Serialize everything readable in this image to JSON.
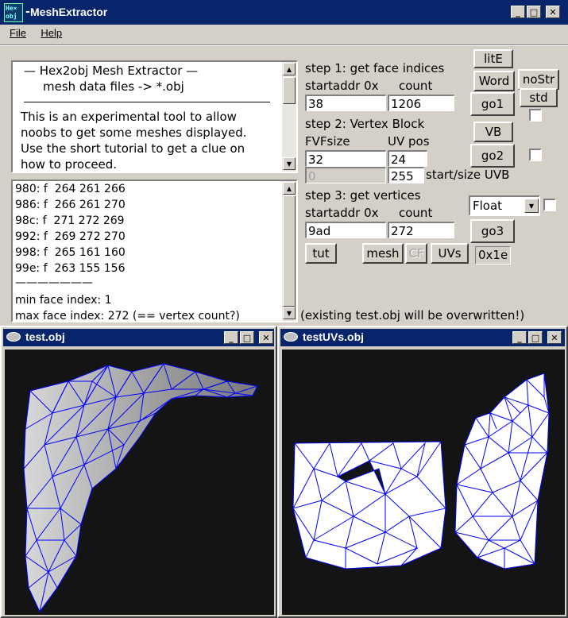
{
  "window": {
    "title": "MeshExtractor",
    "icon_text": "He×\nobj"
  },
  "menu": {
    "file": "File",
    "help": "Help"
  },
  "info": {
    "line1": "—   Hex2obj Mesh Extractor   —",
    "line2": "mesh data files -> *.obj",
    "body": [
      "This is an experimental tool to allow",
      "noobs to get some meshes displayed.",
      "Use the short tutorial to get a clue on",
      "how to proceed."
    ]
  },
  "log": {
    "lines": [
      "980: f  264 261 266",
      "986: f  266 261 270",
      "98c: f  271 272 269",
      "992: f  269 272 270",
      "998: f  265 161 160",
      "99e: f  263 155 156",
      "———————",
      "min face index: 1",
      "max face index: 272 (== vertex count?)"
    ]
  },
  "step1": {
    "title": "step 1: get face indices",
    "addr_label": "startaddr 0x",
    "count_label": "count",
    "addr": "38",
    "count": "1206"
  },
  "step2": {
    "title": "step 2: Vertex Block",
    "fvf_label": "FVFsize",
    "uv_label": "UV pos",
    "fvf": "32",
    "uv": "24",
    "start": "0",
    "size": "255",
    "uvb_label": "start/size UVB"
  },
  "step3": {
    "title": "step 3: get vertices",
    "addr_label": "startaddr 0x",
    "count_label": "count",
    "addr": "9ad",
    "count": "272",
    "type": "Float"
  },
  "buttons": {
    "lite": "litE",
    "word": "Word",
    "nostr": "noStr",
    "std": "std",
    "go1": "go1",
    "vb": "VB",
    "go2": "go2",
    "go3": "go3",
    "tut": "tut",
    "mesh": "mesh",
    "cf": "CF",
    "uvs": "UVs",
    "hex": "0x1e"
  },
  "status": "(existing test.obj will be overwritten!)",
  "win_left": {
    "title": "test.obj"
  },
  "win_right": {
    "title": "testUVs.obj"
  },
  "colors": {
    "titlebar": "#08246b",
    "wire": "#0000ff",
    "viewport_bg": "#141414"
  }
}
